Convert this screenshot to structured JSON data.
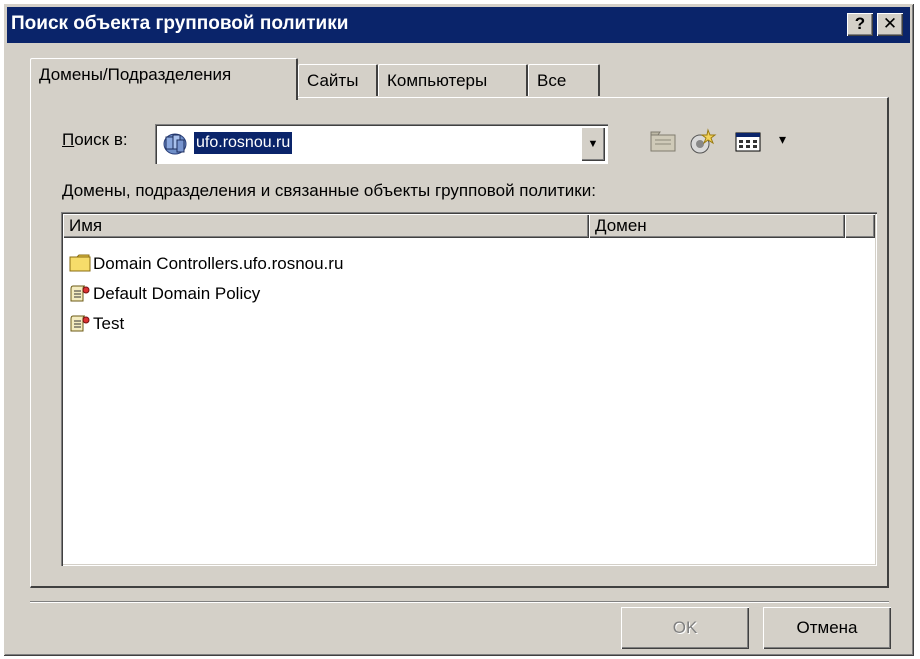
{
  "window": {
    "title": "Поиск объекта групповой политики",
    "help_button": "?",
    "close_button": "✕"
  },
  "tabs": [
    {
      "label": "Домены/Подразделения",
      "active": true
    },
    {
      "label": "Сайты",
      "active": false
    },
    {
      "label": "Компьютеры",
      "active": false
    },
    {
      "label": "Все",
      "active": false
    }
  ],
  "search": {
    "label_prefix": "П",
    "label_rest": "оиск в:",
    "value": "ufo.rosnou.ru",
    "dropdown_glyph": "▼"
  },
  "toolbar": {
    "icons": [
      "up-folder-icon",
      "new-gpo-icon",
      "view-menu-icon"
    ],
    "view_dropdown_glyph": "▾"
  },
  "list": {
    "caption": "Домены, подразделения и связанные объекты групповой политики:",
    "columns": [
      "Имя",
      "Домен",
      ""
    ],
    "rows": [
      {
        "icon": "folder-icon",
        "name": "Domain Controllers.ufo.rosnou.ru",
        "domain": ""
      },
      {
        "icon": "gpo-icon",
        "name": "Default Domain Policy",
        "domain": ""
      },
      {
        "icon": "gpo-icon",
        "name": "Test",
        "domain": ""
      }
    ]
  },
  "buttons": {
    "ok": "OK",
    "cancel": "Отмена"
  },
  "colors": {
    "titlebar": "#0a246a",
    "face": "#d4d0c8",
    "selection": "#0a246a"
  }
}
